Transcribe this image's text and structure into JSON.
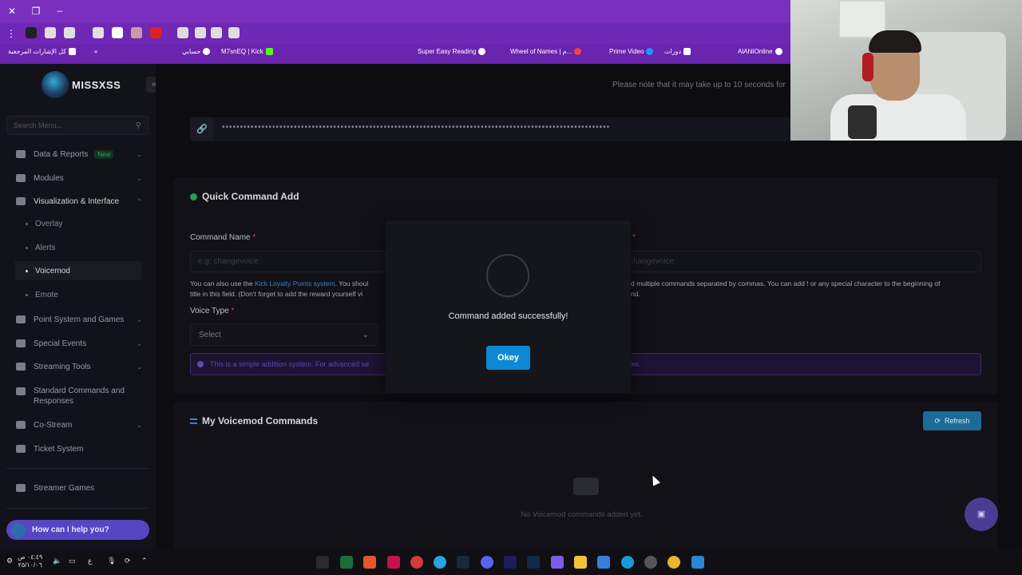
{
  "browser": {
    "bookmarks": [
      {
        "label": "كل الإشارات المرجعية"
      },
      {
        "label": "حسابي"
      },
      {
        "label": "M7snEQ | Kick"
      },
      {
        "label": "Super Easy Reading"
      },
      {
        "label": "Wheel of Names | م..."
      },
      {
        "label": "Prime Video"
      },
      {
        "label": "دورات"
      },
      {
        "label": "AlAhliOnline"
      }
    ]
  },
  "sidebar": {
    "logo_text": "MISSXSS",
    "search_placeholder": "Search Menu...",
    "items": [
      {
        "label": "Data & Reports",
        "badge": "New"
      },
      {
        "label": "Modules"
      },
      {
        "label": "Visualization & Interface"
      },
      {
        "label": "Point System and Games"
      },
      {
        "label": "Special Events"
      },
      {
        "label": "Streaming Tools"
      },
      {
        "label": "Standard Commands and Responses"
      },
      {
        "label": "Co-Stream"
      },
      {
        "label": "Ticket System"
      },
      {
        "label": "Streamer Games"
      }
    ],
    "sub_items": [
      {
        "label": "Overlay"
      },
      {
        "label": "Alerts"
      },
      {
        "label": "Voicemod"
      },
      {
        "label": "Emote"
      }
    ],
    "help_label": "How can I help you?"
  },
  "main": {
    "note": "Please note that it may take up to 10 seconds for",
    "link_value": "••••••••••••••••••••••••••••••••••••••••••••••••••••••••••••••••••••••••••••••••••••••••••••••••••••••••••••",
    "quick": {
      "title": "Quick Command Add",
      "command_name_label": "Command Name",
      "command_placeholder": "e.g: changevoice",
      "right_placeholder": "changevoice",
      "help_left_prefix": "You can also use the ",
      "help_left_link": "Kick Loyalty Points system",
      "help_left_suffix": ". You shoul",
      "help_left_line2": "title in this field. (Don't forget to add the reward yourself vi",
      "help_right_line1": "d multiple commands separated by commas. You can add ! or any special character to the beginning of",
      "help_right_line2": "nd.",
      "voice_type_label": "Voice Type",
      "select_value": "Select",
      "info_left": "This is a simple addition system. For advanced se",
      "info_right": "below."
    },
    "voicemod": {
      "title": "My Voicemod Commands",
      "refresh_label": "Refresh",
      "empty_text": "No Voicemod commands added yet."
    }
  },
  "modal": {
    "message": "Command added successfully!",
    "button_label": "Okey"
  },
  "taskbar": {
    "clock_time": "٠٤:٤٩ ص",
    "clock_date": "٢٥/١٠/٠٦",
    "lang": "ع"
  }
}
